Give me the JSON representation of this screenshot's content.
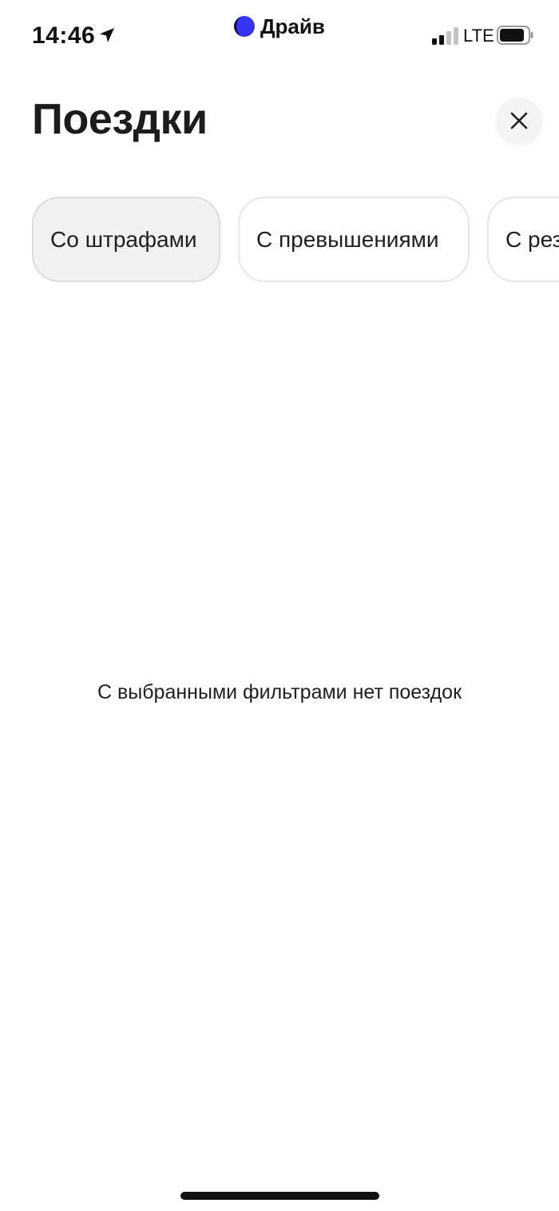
{
  "status_bar": {
    "time": "14:46",
    "network": "LTE",
    "icons": [
      "location-arrow-icon",
      "signal-bars-icon",
      "battery-icon"
    ]
  },
  "app": {
    "name": "Драйв",
    "logo_icon": "drive-logo-icon",
    "logo_color": "#3535f3"
  },
  "header": {
    "title": "Поездки",
    "close_icon": "close-icon"
  },
  "filters": [
    {
      "label": "Со штрафами",
      "selected": true
    },
    {
      "label": "С превышениями",
      "selected": false
    },
    {
      "label": "С резервом",
      "selected": false
    }
  ],
  "empty_state": {
    "message": "С выбранными фильтрами нет поездок"
  }
}
